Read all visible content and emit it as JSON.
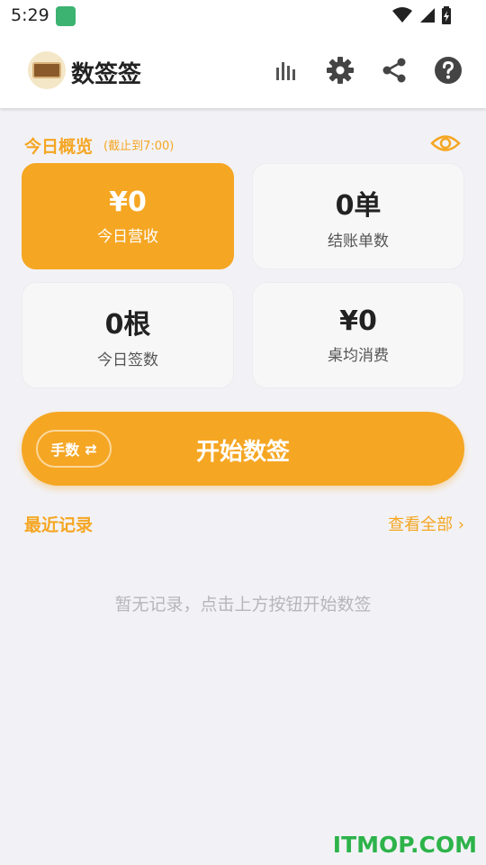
{
  "status_bar": {
    "time": "5:29"
  },
  "app_bar": {
    "title": "数签签",
    "icons": [
      "bar-chart-icon",
      "gear-icon",
      "share-icon",
      "help-icon"
    ]
  },
  "overview": {
    "title": "今日概览",
    "subtitle": "(截止到7:00)",
    "cards": [
      {
        "value": "¥0",
        "label": "今日营收"
      },
      {
        "value": "0单",
        "label": "结账单数"
      },
      {
        "value": "0根",
        "label": "今日签数"
      },
      {
        "value": "¥0",
        "label": "桌均消费"
      }
    ]
  },
  "start": {
    "mode_label": "手数",
    "mode_icon": "⇄",
    "label": "开始数签"
  },
  "recent": {
    "title": "最近记录",
    "view_all": "查看全部 ›",
    "empty": "暂无记录，点击上方按钮开始数签"
  },
  "watermark": "ITMOP.COM",
  "colors": {
    "accent": "#f5a623",
    "background": "#f2f2f6",
    "card": "#f7f7f8",
    "watermark": "#2db34a"
  }
}
